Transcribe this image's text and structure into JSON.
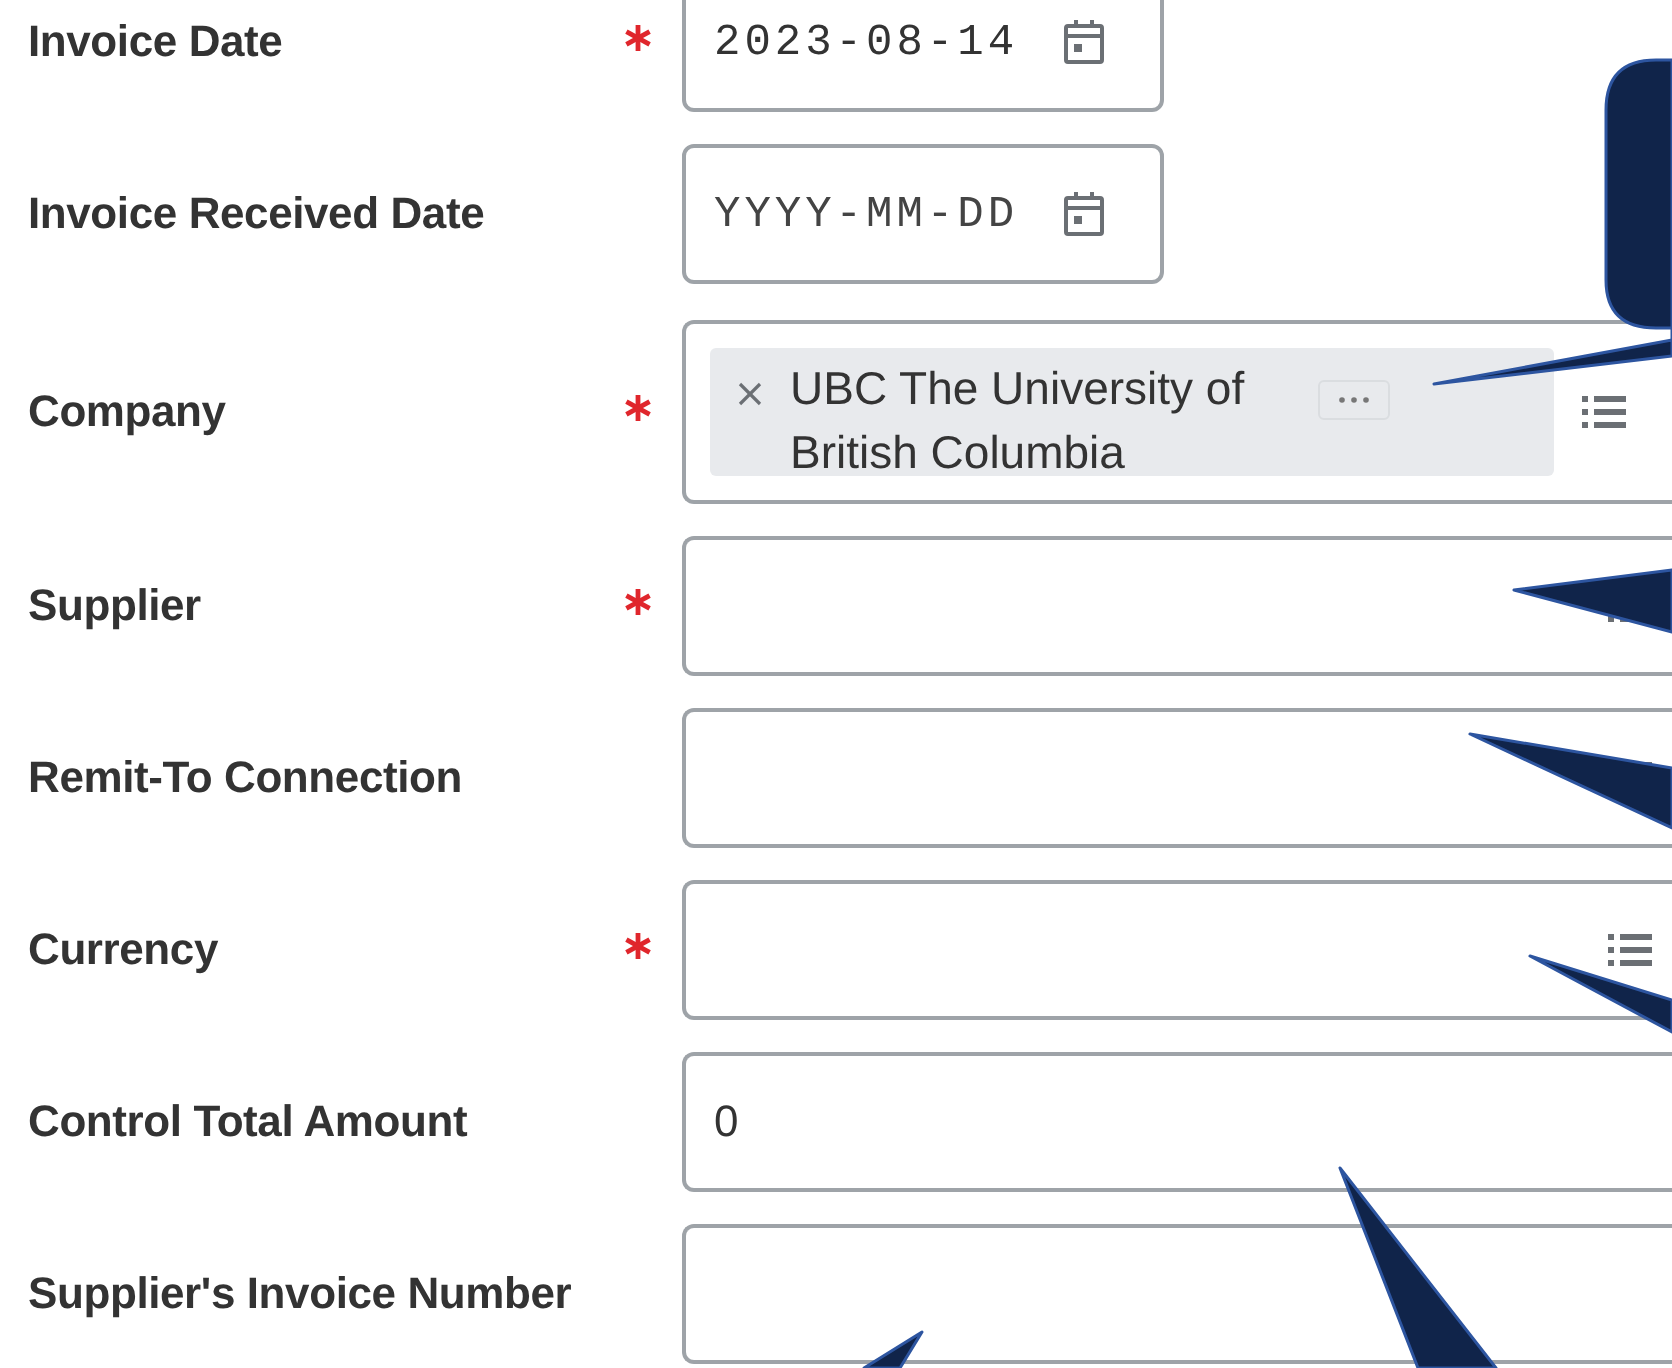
{
  "fields": [
    {
      "label": "Invoice Date",
      "required": true,
      "kind": "date",
      "value": "2023-08-14"
    },
    {
      "label": "Invoice Received Date",
      "required": false,
      "kind": "date",
      "placeholder": "YYYY-MM-DD"
    },
    {
      "label": "Company",
      "required": true,
      "kind": "multiselect",
      "selections": [
        "UBC The University of British Columbia"
      ]
    },
    {
      "label": "Supplier",
      "required": true,
      "kind": "select"
    },
    {
      "label": "Remit-To Connection",
      "required": false,
      "kind": "select"
    },
    {
      "label": "Currency",
      "required": true,
      "kind": "select"
    },
    {
      "label": "Control Total Amount",
      "required": false,
      "kind": "text",
      "value": "0"
    },
    {
      "label": "Supplier's Invoice Number",
      "required": false,
      "kind": "text"
    }
  ]
}
